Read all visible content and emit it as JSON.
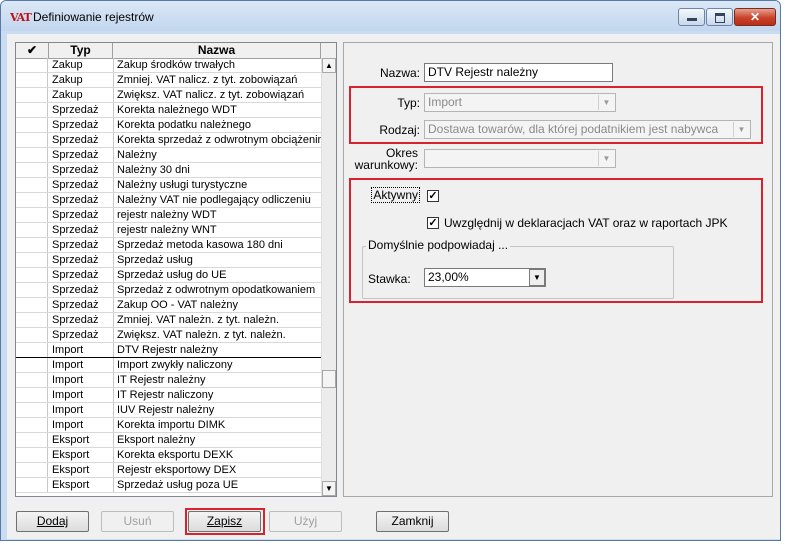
{
  "window": {
    "icon_text": "VAT",
    "title": "Definiowanie rejestrów"
  },
  "grid": {
    "col_check_icon": "✔",
    "col_typ": "Typ",
    "col_nazwa": "Nazwa",
    "rows": [
      {
        "typ": "Zakup",
        "nazwa": "Zakup środków trwałych"
      },
      {
        "typ": "Zakup",
        "nazwa": "Zmniej. VAT nalicz. z tyt. zobowiązań"
      },
      {
        "typ": "Zakup",
        "nazwa": "Zwiększ. VAT nalicz. z tyt. zobowiązań"
      },
      {
        "typ": "Sprzedaż",
        "nazwa": "Korekta należnego WDT"
      },
      {
        "typ": "Sprzedaż",
        "nazwa": "Korekta podatku należnego"
      },
      {
        "typ": "Sprzedaż",
        "nazwa": "Korekta sprzedaż z odwrotnym obciążenim"
      },
      {
        "typ": "Sprzedaż",
        "nazwa": "Należny"
      },
      {
        "typ": "Sprzedaż",
        "nazwa": "Należny 30 dni"
      },
      {
        "typ": "Sprzedaż",
        "nazwa": "Należny usługi turystyczne"
      },
      {
        "typ": "Sprzedaż",
        "nazwa": "Należny VAT nie podlegający odliczeniu"
      },
      {
        "typ": "Sprzedaż",
        "nazwa": "rejestr należny WDT"
      },
      {
        "typ": "Sprzedaż",
        "nazwa": "rejestr należny WNT"
      },
      {
        "typ": "Sprzedaż",
        "nazwa": "Sprzedaż metoda kasowa 180 dni"
      },
      {
        "typ": "Sprzedaż",
        "nazwa": "Sprzedaż usług"
      },
      {
        "typ": "Sprzedaż",
        "nazwa": "Sprzedaż usług do UE"
      },
      {
        "typ": "Sprzedaż",
        "nazwa": "Sprzedaż z odwrotnym opodatkowaniem"
      },
      {
        "typ": "Sprzedaż",
        "nazwa": "Zakup OO - VAT należny"
      },
      {
        "typ": "Sprzedaż",
        "nazwa": "Zmniej. VAT należn. z tyt. należn."
      },
      {
        "typ": "Sprzedaż",
        "nazwa": "Zwiększ. VAT należn. z tyt. należn."
      },
      {
        "typ": "Import",
        "nazwa": "DTV Rejestr należny"
      },
      {
        "typ": "Import",
        "nazwa": "Import zwykły naliczony"
      },
      {
        "typ": "Import",
        "nazwa": "IT Rejestr należny"
      },
      {
        "typ": "Import",
        "nazwa": "IT Rejestr naliczony"
      },
      {
        "typ": "Import",
        "nazwa": "IUV Rejestr należny"
      },
      {
        "typ": "Import",
        "nazwa": "Korekta importu DIMK"
      },
      {
        "typ": "Eksport",
        "nazwa": "Eksport należny"
      },
      {
        "typ": "Eksport",
        "nazwa": "Korekta eksportu DEXK"
      },
      {
        "typ": "Eksport",
        "nazwa": "Rejestr eksportowy DEX"
      },
      {
        "typ": "Eksport",
        "nazwa": "Sprzedaż usług poza UE"
      }
    ]
  },
  "form": {
    "nazwa_label": "Nazwa:",
    "nazwa_value": "DTV Rejestr należny",
    "typ_label": "Typ:",
    "typ_value": "Import",
    "rodzaj_label": "Rodzaj:",
    "rodzaj_value": "Dostawa towarów, dla której podatnikiem jest nabywca",
    "okres_label_1": "Okres",
    "okres_label_2": "warunkowy:",
    "okres_value": "",
    "aktywny_label": "Aktywny",
    "uwzglednij_label": "Uwzględnij w deklaracjach VAT oraz w raportach JPK",
    "group_title": "Domyślnie podpowiadaj ...",
    "stawka_label": "Stawka:",
    "stawka_value": "23,00%"
  },
  "buttons": {
    "dodaj": "Dodaj",
    "usun": "Usuń",
    "zapisz": "Zapisz",
    "uzyj": "Użyj",
    "zamknij": "Zamknij"
  },
  "colors": {
    "highlight_red": "#d7232e"
  }
}
